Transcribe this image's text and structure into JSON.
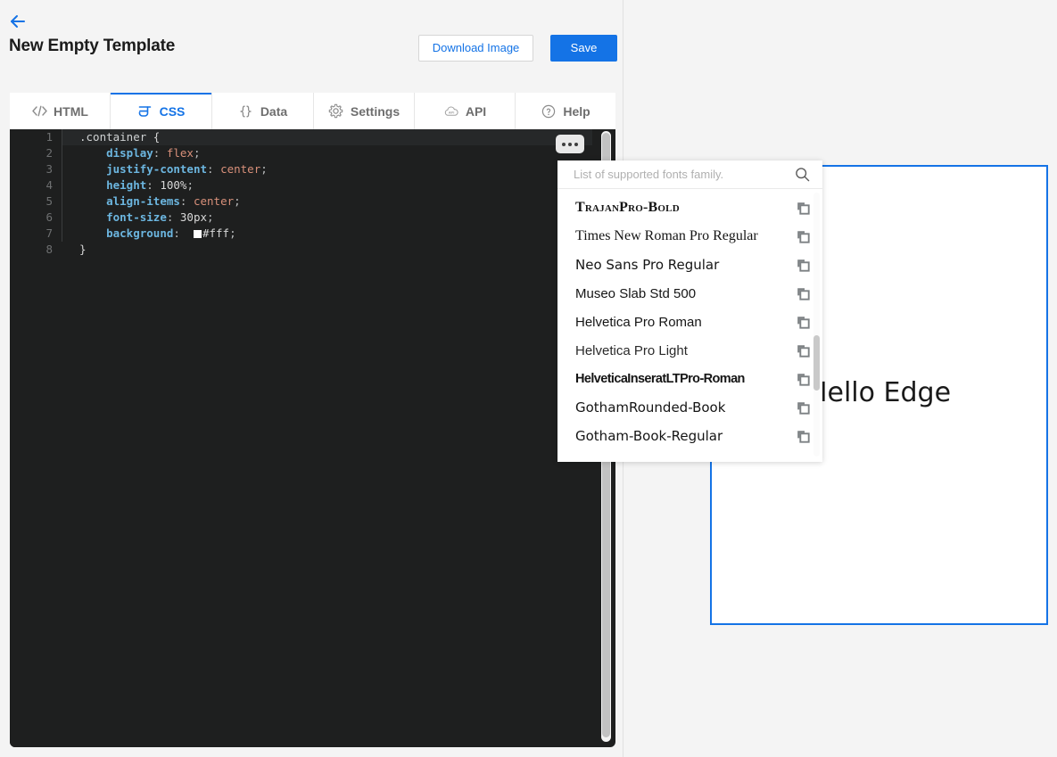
{
  "header": {
    "back_icon": "back-arrow-icon",
    "title": "New Empty Template",
    "download_label": "Download Image",
    "save_label": "Save",
    "accent_color": "#1473e6"
  },
  "tabs": [
    {
      "label": "HTML",
      "icon": "code-brackets-icon",
      "active": false
    },
    {
      "label": "CSS",
      "icon": "css-icon",
      "active": true
    },
    {
      "label": "Data",
      "icon": "curly-braces-icon",
      "active": false
    },
    {
      "label": "Settings",
      "icon": "gear-icon",
      "active": false
    },
    {
      "label": "API",
      "icon": "cloud-api-icon",
      "active": false
    },
    {
      "label": "Help",
      "icon": "question-circle-icon",
      "active": false
    }
  ],
  "editor": {
    "language": "CSS",
    "options_button": "ellipsis-button",
    "line_numbers": [
      "1",
      "2",
      "3",
      "4",
      "5",
      "6",
      "7",
      "8"
    ],
    "lines": [
      {
        "n": "1",
        "selector": ".container",
        "brace": " {"
      },
      {
        "n": "2",
        "prop": "display",
        "colon": ": ",
        "value": "flex",
        "semi": ";"
      },
      {
        "n": "3",
        "prop": "justify-content",
        "colon": ": ",
        "value": "center",
        "semi": ";"
      },
      {
        "n": "4",
        "prop": "height",
        "colon": ": ",
        "value": "100%",
        "semi": ";"
      },
      {
        "n": "5",
        "prop": "align-items",
        "colon": ": ",
        "value": "center",
        "semi": ";"
      },
      {
        "n": "6",
        "prop": "font-size",
        "colon": ": ",
        "value": "30px",
        "semi": ";"
      },
      {
        "n": "7",
        "prop": "background",
        "colon": ": ",
        "value": "#fff",
        "semi": ";",
        "swatch": "#ffffff"
      },
      {
        "n": "8",
        "close": "}"
      }
    ]
  },
  "font_dropdown": {
    "search_placeholder": "List of supported fonts family.",
    "search_value": "",
    "search_icon": "search-icon",
    "copy_icon": "copy-icon",
    "fonts": [
      {
        "name": "TrajanPro-Bold"
      },
      {
        "name": "Times New Roman Pro Regular"
      },
      {
        "name": "Neo Sans Pro Regular"
      },
      {
        "name": "Museo Slab Std 500"
      },
      {
        "name": "Helvetica Pro Roman"
      },
      {
        "name": "Helvetica Pro Light"
      },
      {
        "name": "HelveticaInseratLTPro-Roman"
      },
      {
        "name": "GothamRounded-Book"
      },
      {
        "name": "Gotham-Book-Regular"
      }
    ]
  },
  "preview": {
    "text": "Hello Edge",
    "border_color": "#1473e6",
    "background": "#ffffff"
  }
}
